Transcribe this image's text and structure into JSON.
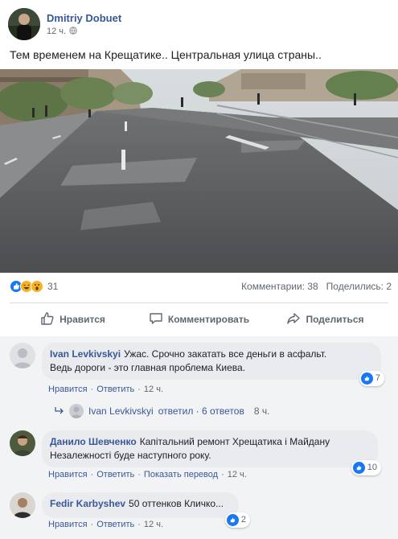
{
  "post": {
    "author": "Dmitriy Dobuet",
    "time": "12 ч.",
    "text": "Тем временем на Крещатике.. Центральная улица страны.."
  },
  "reactions": {
    "icons": [
      "like-icon",
      "haha-icon",
      "wow-icon"
    ],
    "count": "31",
    "comments_text": "Комментарии: 38",
    "shares_text": "Поделились: 2"
  },
  "actions": {
    "like": "Нравится",
    "comment": "Комментировать",
    "share": "Поделиться"
  },
  "comments": [
    {
      "name": "Ivan Levkivskyi",
      "text_line1": "Ужас. Срочно закатать все деньги в асфальт.",
      "text_line2": "Ведь дороги - это главная проблема Киева.",
      "likes": "7",
      "like_label": "Нравится",
      "reply_label": "Ответить",
      "time": "12 ч."
    },
    {
      "name": "Данило Шевченко",
      "text_line1": "Капітальний ремонт Хрещатика і Майдану",
      "text_line2": "Незалежності буде наступного року.",
      "likes": "10",
      "like_label": "Нравится",
      "reply_label": "Ответить",
      "translate_label": "Показать перевод",
      "time": "12 ч."
    },
    {
      "name": "Fedir Karbyshev",
      "text_line1": "50 оттенков Кличко...",
      "likes": "2",
      "like_label": "Нравится",
      "reply_label": "Ответить",
      "time": "12 ч."
    }
  ],
  "replies": {
    "replier": "Ivan Levkivskyi",
    "text": "ответил · 6 ответов",
    "time": "8 ч."
  },
  "colors": {
    "link": "#385898",
    "like_blue": "#1877f2",
    "muted": "#606770",
    "bubble": "#e9ebee"
  }
}
